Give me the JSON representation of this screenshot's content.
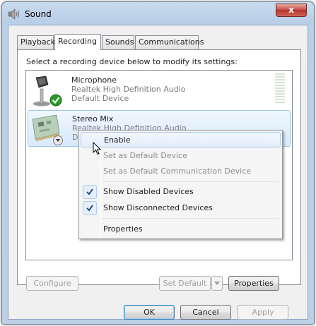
{
  "window": {
    "title": "Sound",
    "close_label": "x"
  },
  "tabs": [
    {
      "label": "Playback"
    },
    {
      "label": "Recording"
    },
    {
      "label": "Sounds"
    },
    {
      "label": "Communications"
    }
  ],
  "panel": {
    "instruction": "Select a recording device below to modify its settings:"
  },
  "devices": [
    {
      "name": "Microphone",
      "driver": "Realtek High Definition Audio",
      "status": "Default Device"
    },
    {
      "name": "Stereo Mix",
      "driver": "Realtek High Definition Audio",
      "status": "D"
    }
  ],
  "buttons": {
    "configure": "Configure",
    "set_default": "Set Default",
    "properties": "Properties",
    "ok": "OK",
    "cancel": "Cancel",
    "apply": "Apply"
  },
  "context_menu": {
    "enable": "Enable",
    "set_default_device": "Set as Default Device",
    "set_default_comm": "Set as Default Communication Device",
    "show_disabled": "Show Disabled Devices",
    "show_disconnected": "Show Disconnected Devices",
    "properties": "Properties"
  },
  "colors": {
    "accent": "#3c7fb1",
    "selection": "#d7e9fb",
    "check_green": "#2a9a2a",
    "disabled_text": "#8d8d8d"
  },
  "icons": {
    "window": "speaker-icon",
    "microphone": "microphone-icon",
    "stereo_mix": "sound-card-icon",
    "default_badge": "green-check-icon",
    "disabled_badge": "down-arrow-badge-icon",
    "menu_check": "checkmark-icon",
    "cursor": "mouse-pointer-icon"
  }
}
